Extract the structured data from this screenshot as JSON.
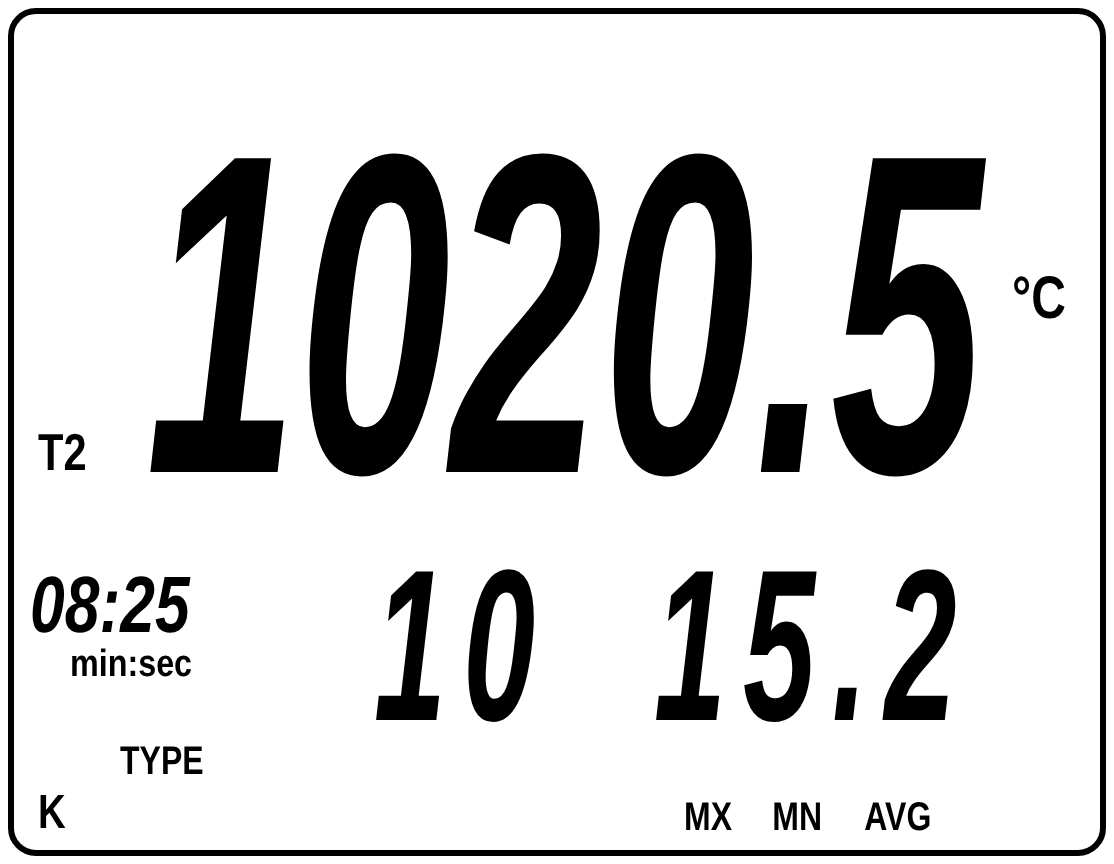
{
  "main_reading": {
    "label": "T2",
    "value": "1020.5",
    "unit": "°C"
  },
  "timer": {
    "value": "08:25",
    "unit": "min:sec"
  },
  "secondary_reading": {
    "values": [
      "10",
      "15.2"
    ]
  },
  "thermocouple": {
    "label": "TYPE",
    "value": "K"
  },
  "stat_labels": [
    "MX",
    "MN",
    "AVG"
  ]
}
